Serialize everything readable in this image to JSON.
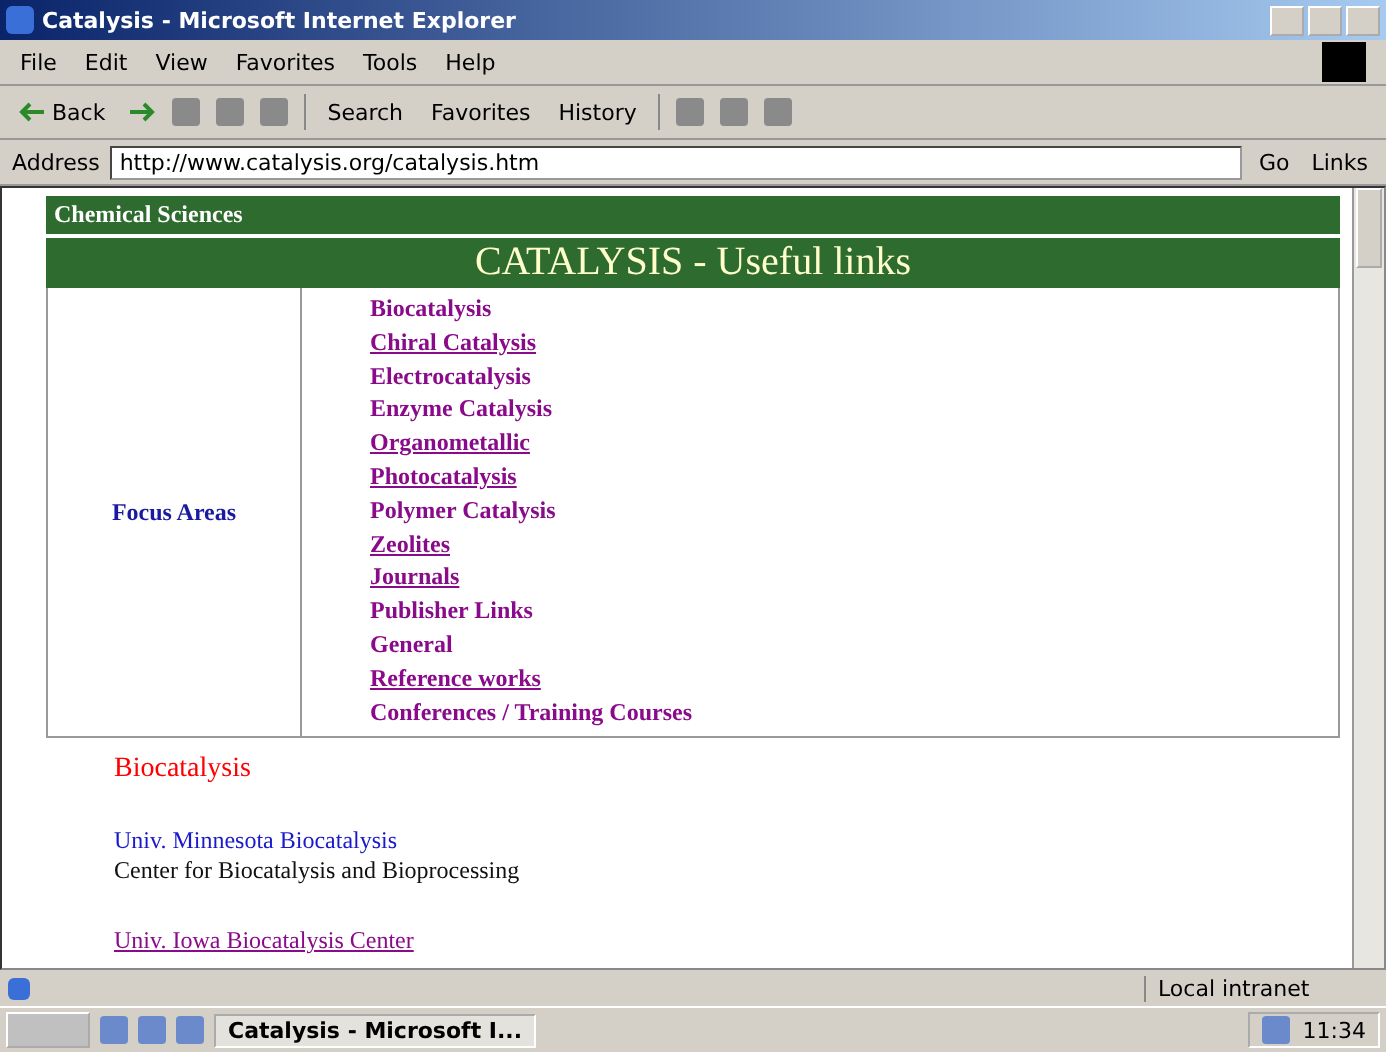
{
  "window": {
    "title": "Catalysis - Microsoft Internet Explorer"
  },
  "menu": [
    "File",
    "Edit",
    "View",
    "Favorites",
    "Tools",
    "Help"
  ],
  "toolbar": {
    "back": "Back",
    "search": "Search",
    "favorites": "Favorites",
    "history": "History"
  },
  "address": {
    "label": "Address",
    "value": "http://www.catalysis.org/catalysis.htm",
    "go": "Go",
    "links": "Links"
  },
  "page": {
    "section": "Chemical Sciences",
    "heading": "CATALYSIS - Useful links",
    "focus_label": "Focus Areas",
    "links": [
      {
        "text": "Biocatalysis",
        "visited": false
      },
      {
        "text": "Chiral Catalysis",
        "visited": true
      },
      {
        "text": "Electrocatalysis",
        "visited": false
      },
      {
        "text": "Enzyme Catalysis",
        "visited": false
      },
      {
        "text": "Organometallic",
        "visited": true
      },
      {
        "text": "Photocatalysis",
        "visited": true
      },
      {
        "text": "Polymer Catalysis",
        "visited": false
      },
      {
        "text": "Zeolites",
        "visited": true
      },
      {
        "text": "Journals",
        "visited": true
      },
      {
        "text": "Publisher Links",
        "visited": false
      },
      {
        "text": "General",
        "visited": false
      },
      {
        "text": "Reference works",
        "visited": true
      },
      {
        "text": "Conferences / Training Courses",
        "visited": false
      }
    ],
    "subheading": "Biocatalysis",
    "entries": [
      {
        "link": "Univ. Minnesota Biocatalysis",
        "visited": false,
        "note": "Center for Biocatalysis and Bioprocessing"
      },
      {
        "link": "Univ. Iowa Biocatalysis Center",
        "visited": true
      }
    ]
  },
  "status_bar": {
    "zone": "Local intranet"
  },
  "taskbar": {
    "window": "Catalysis - Microsoft I...",
    "clock": "11:34"
  }
}
